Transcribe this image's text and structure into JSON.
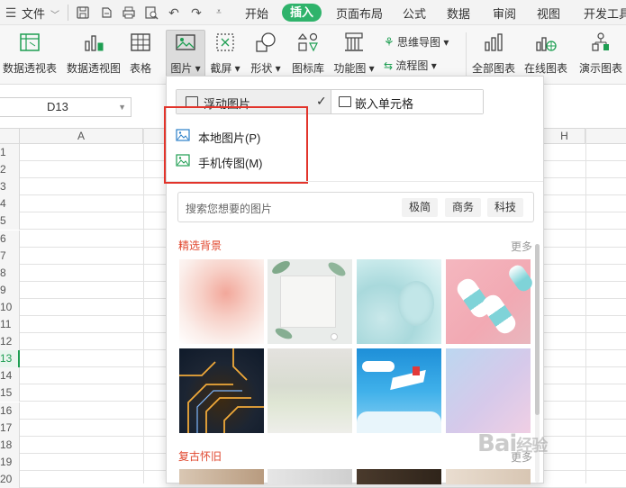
{
  "menubar": {
    "file_label": "文件",
    "tabs": [
      "开始",
      "插入",
      "页面布局",
      "公式",
      "数据",
      "审阅",
      "视图",
      "开发工具"
    ],
    "active_tab": "插入"
  },
  "ribbon": {
    "buttons": {
      "pivot_table": "数据透视表",
      "pivot_chart": "数据透视图",
      "table": "表格",
      "picture": "图片",
      "screenshot": "截屏",
      "shape": "形状",
      "icon_lib": "图标库",
      "func_chart": "功能图",
      "mind_map": "思维导图",
      "flowchart": "流程图",
      "all_charts": "全部图表",
      "online_chart": "在线图表",
      "demo_chart": "演示图表"
    }
  },
  "namebox": {
    "value": "D13"
  },
  "grid": {
    "columns": [
      "A",
      "H"
    ],
    "rows": [
      "1",
      "2",
      "3",
      "4",
      "5",
      "6",
      "7",
      "8",
      "9",
      "10",
      "11",
      "12",
      "13",
      "14",
      "15",
      "16",
      "17",
      "18",
      "19",
      "20"
    ],
    "selected_row": "13"
  },
  "picture_panel": {
    "toggle": {
      "floating": "浮动图片",
      "embed": "嵌入单元格"
    },
    "menu": {
      "local": "本地图片(P)",
      "phone": "手机传图(M)"
    },
    "search": {
      "placeholder": "搜索您想要的图片",
      "tags": [
        "极简",
        "商务",
        "科技"
      ]
    },
    "sections": [
      {
        "title": "精选背景",
        "more": "更多"
      },
      {
        "title": "复古怀旧",
        "more": "更多"
      }
    ]
  },
  "watermark": {
    "text": "Bai",
    "suffix": "经验"
  },
  "colors": {
    "accent": "#2fb36b",
    "highlight": "#e2342b",
    "section": "#e0472e"
  }
}
